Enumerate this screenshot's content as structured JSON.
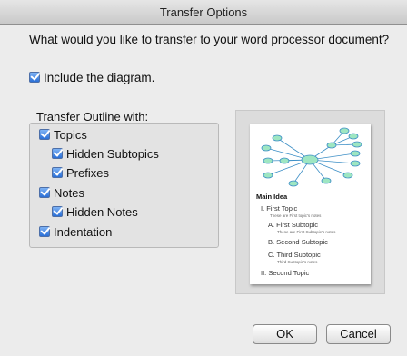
{
  "window": {
    "title": "Transfer Options"
  },
  "question": "What would you like to transfer to your word processor document?",
  "include_diagram": {
    "label": "Include the diagram.",
    "checked": true
  },
  "outline": {
    "label": "Transfer Outline with:",
    "options": {
      "topics": "Topics",
      "hidden_subtopics": "Hidden Subtopics",
      "prefixes": "Prefixes",
      "notes": "Notes",
      "hidden_notes": "Hidden Notes",
      "indentation": "Indentation"
    }
  },
  "preview": {
    "main_idea": "Main Idea",
    "first_topic": "I. First Topic",
    "first_topic_note": "These are First topic's notes",
    "first_subtopic": "A. First Subtopic",
    "first_subtopic_note": "These are First Subtopic's notes",
    "second_subtopic": "B. Second Subtopic",
    "third_subtopic": "C. Third Subtopic",
    "third_subtopic_note": "Third Subtopic's notes",
    "second_topic": "II. Second Topic"
  },
  "buttons": {
    "ok": "OK",
    "cancel": "Cancel"
  },
  "colors": {
    "checkbox": "#2a6fd6",
    "node": "#9ee6c2",
    "node_stroke": "#3d8fc6"
  }
}
